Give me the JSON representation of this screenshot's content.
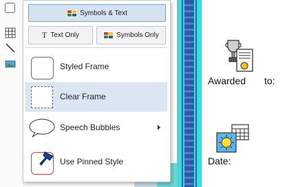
{
  "menu": {
    "symbols_text_label": "Symbols & Text",
    "text_only_label": "Text Only",
    "symbols_only_label": "Symbols Only",
    "text_only_prefix": "T",
    "items": [
      {
        "label": "Styled Frame"
      },
      {
        "label": "Clear Frame"
      },
      {
        "label": "Speech Bubbles"
      },
      {
        "label": "Use Pinned Style"
      }
    ]
  },
  "document": {
    "awarded_label": "Awarded",
    "to_label": "to:",
    "date_label": "Date:"
  },
  "colors": {
    "selected_bg": "#d5e3f1",
    "hover_bg": "#dbe6f2",
    "stripe": "#43d6e0",
    "frame_border": "#4b6fa6"
  }
}
